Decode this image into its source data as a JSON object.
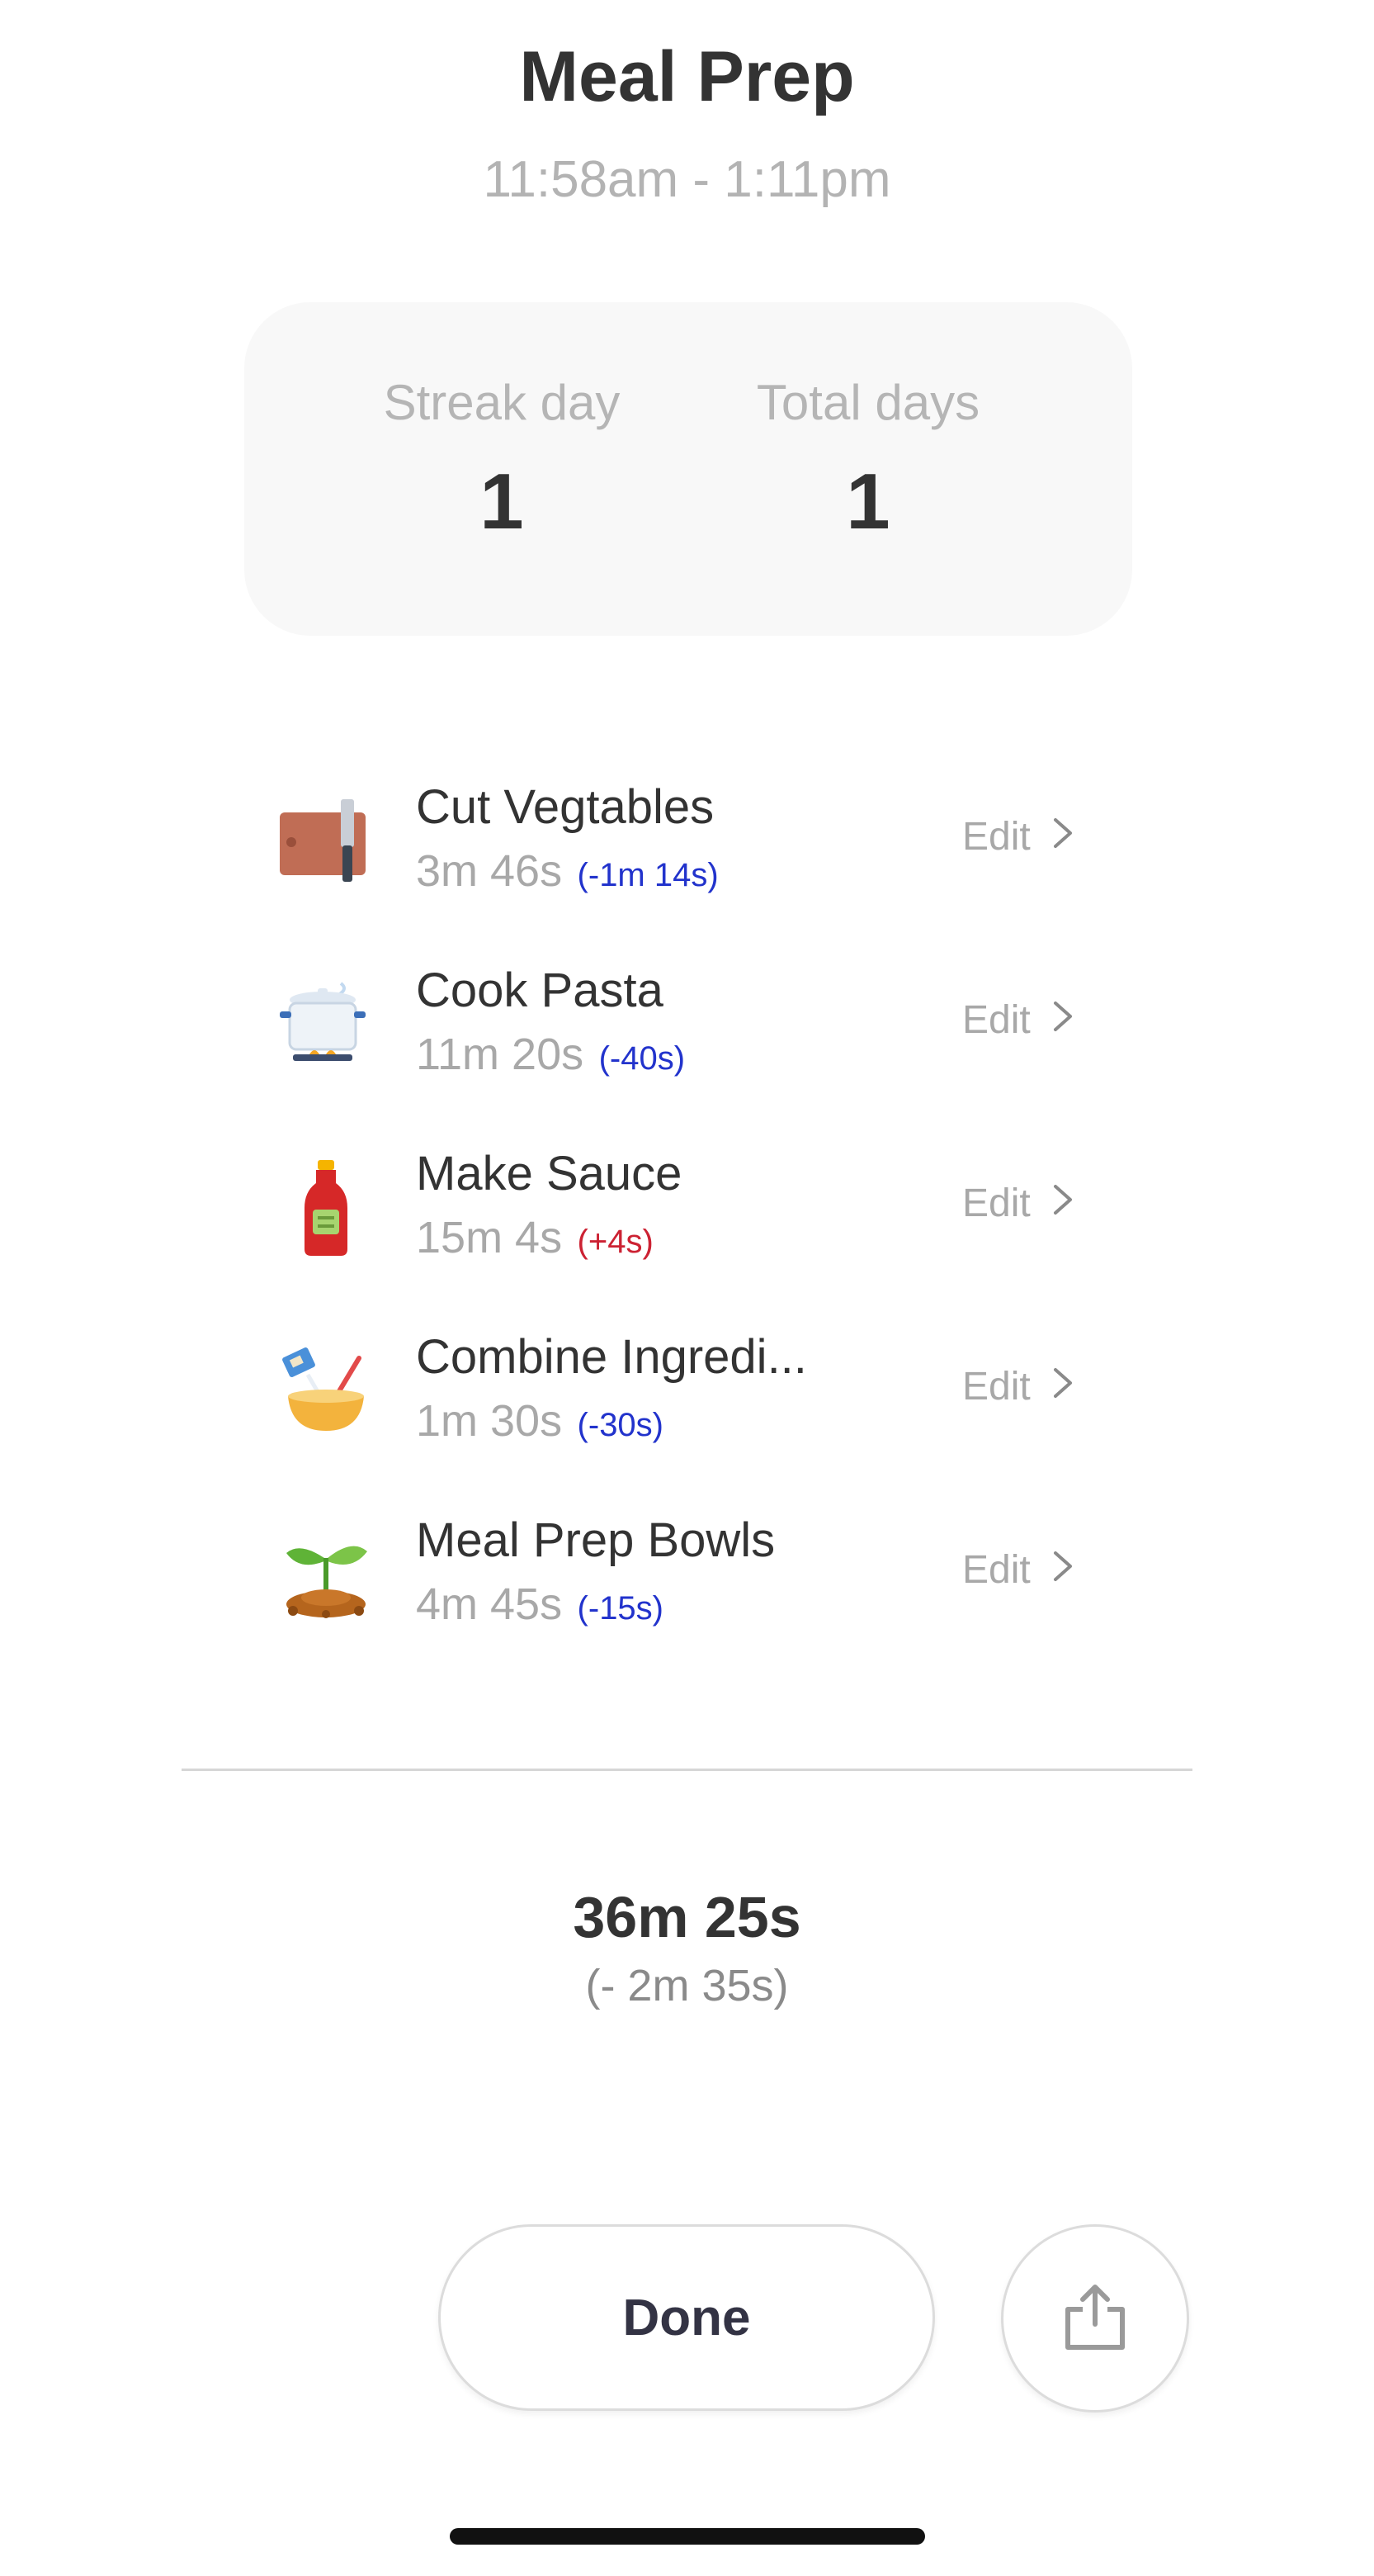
{
  "header": {
    "title": "Meal Prep",
    "time_range": "11:58am - 1:11pm"
  },
  "stats": {
    "streak_label": "Streak day",
    "streak_value": "1",
    "total_label": "Total days",
    "total_value": "1"
  },
  "tasks": [
    {
      "name": "Cut Vegtables",
      "duration": "3m 46s",
      "delta": "(-1m 14s)",
      "delta_color": "#2233cc",
      "icon": "cutting-board-knife-icon",
      "edit_label": "Edit"
    },
    {
      "name": "Cook Pasta",
      "duration": "11m 20s",
      "delta": "(-40s)",
      "delta_color": "#2233cc",
      "icon": "cooking-pot-icon",
      "edit_label": "Edit"
    },
    {
      "name": "Make Sauce",
      "duration": "15m 4s",
      "delta": "(+4s)",
      "delta_color": "#cc2233",
      "icon": "ketchup-bottle-icon",
      "edit_label": "Edit"
    },
    {
      "name": "Combine Ingredi...",
      "duration": "1m 30s",
      "delta": "(-30s)",
      "delta_color": "#2233cc",
      "icon": "mixing-bowl-icon",
      "edit_label": "Edit"
    },
    {
      "name": "Meal Prep Bowls",
      "duration": "4m 45s",
      "delta": "(-15s)",
      "delta_color": "#2233cc",
      "icon": "sprout-icon",
      "edit_label": "Edit"
    }
  ],
  "summary": {
    "total_time": "36m 25s",
    "total_delta": "(- 2m 35s)"
  },
  "actions": {
    "done_label": "Done",
    "share_icon": "share-icon"
  }
}
